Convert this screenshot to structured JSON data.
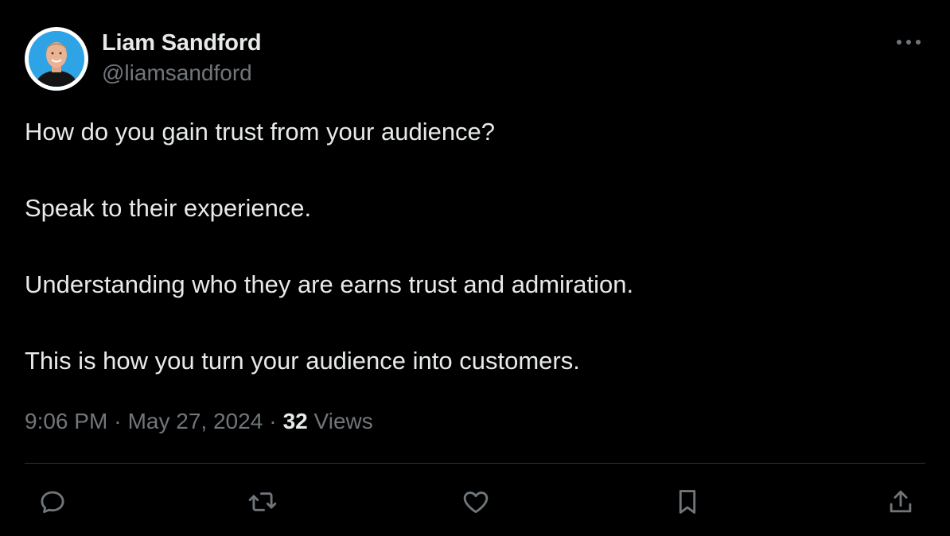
{
  "author": {
    "display_name": "Liam Sandford",
    "handle": "@liamsandford"
  },
  "tweet": {
    "paragraphs": [
      "How do you gain trust from your audience?",
      "Speak to their experience.",
      "Understanding who they are earns trust and admiration.",
      "This is how you turn your audience into customers."
    ],
    "time": "9:06 PM",
    "date": "May 27, 2024",
    "views_count": "32",
    "views_label": "Views",
    "separator": "·"
  },
  "actions": [
    "reply-icon",
    "retweet-icon",
    "like-icon",
    "bookmark-icon",
    "share-icon"
  ],
  "icons": {
    "more": "more-icon"
  },
  "colors": {
    "background": "#000000",
    "primary_text": "#e7e9ea",
    "secondary_text": "#71767b",
    "divider": "#2f3336",
    "avatar_background": "#2ea3e6"
  }
}
